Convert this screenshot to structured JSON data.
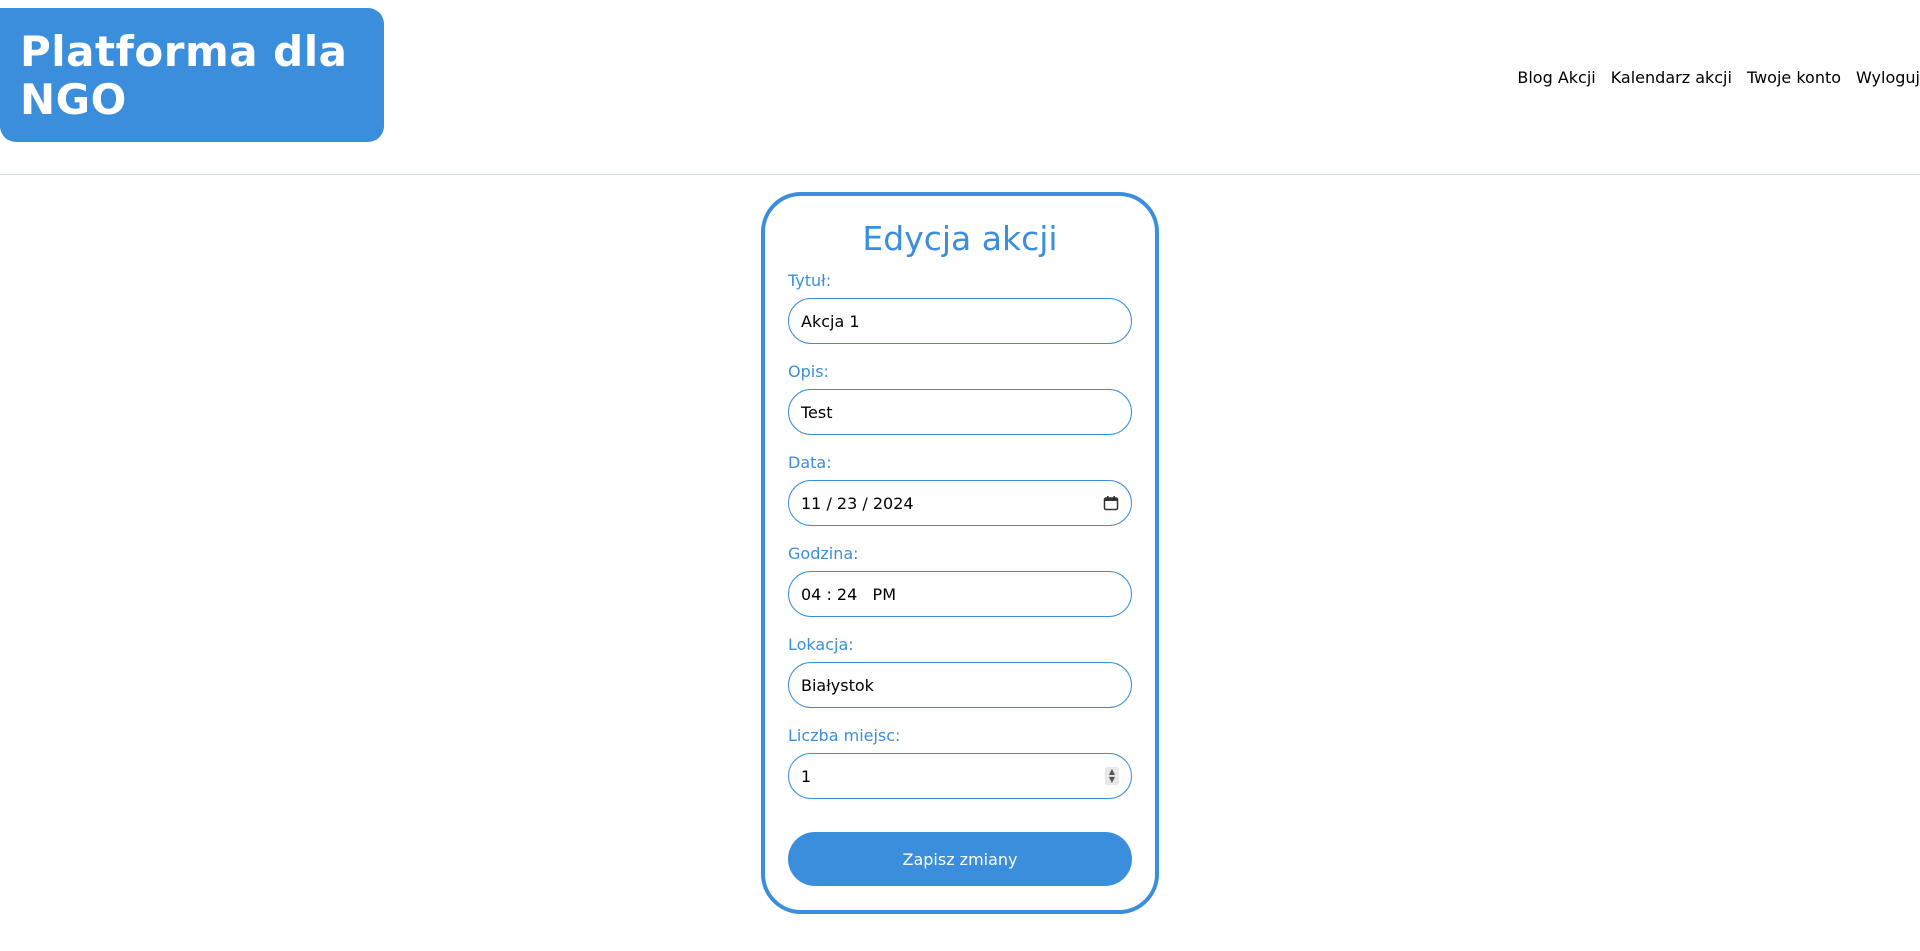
{
  "header": {
    "logo_text": "Platforma dla NGO",
    "nav": [
      {
        "label": "Blog Akcji"
      },
      {
        "label": "Kalendarz akcji"
      },
      {
        "label": "Twoje konto"
      },
      {
        "label": "Wyloguj"
      }
    ]
  },
  "form": {
    "title": "Edycja akcji",
    "fields": {
      "title": {
        "label": "Tytuł:",
        "value": "Akcja 1"
      },
      "description": {
        "label": "Opis:",
        "value": "Test"
      },
      "date": {
        "label": "Data:",
        "value": "11 / 23 / 2024",
        "icon": "calendar-icon"
      },
      "time": {
        "label": "Godzina:",
        "value": "04 : 24   PM"
      },
      "location": {
        "label": "Lokacja:",
        "value": "Białystok"
      },
      "seats": {
        "label": "Liczba miejsc:",
        "value": "1",
        "icon": "number-spinner-icon"
      }
    },
    "submit_label": "Zapisz zmiany"
  },
  "colors": {
    "accent": "#3a8edc",
    "text": "#000000",
    "background": "#ffffff"
  }
}
